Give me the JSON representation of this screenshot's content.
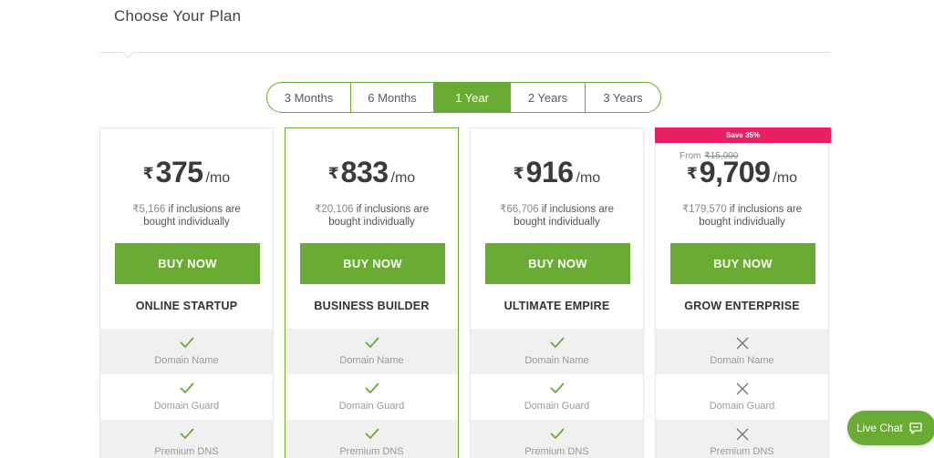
{
  "header": {
    "title": "Choose Your Plan"
  },
  "durations": [
    {
      "label": "3 Months",
      "active": false
    },
    {
      "label": "6 Months",
      "active": false
    },
    {
      "label": "1 Year",
      "active": true
    },
    {
      "label": "2 Years",
      "active": false
    },
    {
      "label": "3 Years",
      "active": false
    }
  ],
  "currency": "₹",
  "per": "/mo",
  "inclusion_suffix": " if inclusions are",
  "inclusion_suffix2": "bought individually",
  "buy_label": "BUY NOW",
  "plans": [
    {
      "name": "ONLINE STARTUP",
      "price": "375",
      "inclusion_value": "₹5,166",
      "featured": false,
      "features": [
        {
          "label": "Domain Name",
          "icon": "check-icon"
        },
        {
          "label": "Domain Guard",
          "icon": "check-icon"
        },
        {
          "label": "Premium DNS",
          "icon": "check-icon"
        }
      ]
    },
    {
      "name": "BUSINESS BUILDER",
      "price": "833",
      "inclusion_value": "₹20,106",
      "featured": true,
      "features": [
        {
          "label": "Domain Name",
          "icon": "check-icon"
        },
        {
          "label": "Domain Guard",
          "icon": "check-icon"
        },
        {
          "label": "Premium DNS",
          "icon": "check-icon"
        }
      ]
    },
    {
      "name": "ULTIMATE EMPIRE",
      "price": "916",
      "inclusion_value": "₹66,706",
      "featured": false,
      "features": [
        {
          "label": "Domain Name",
          "icon": "check-icon"
        },
        {
          "label": "Domain Guard",
          "icon": "check-icon"
        },
        {
          "label": "Premium DNS",
          "icon": "check-icon"
        }
      ]
    },
    {
      "name": "GROW ENTERPRISE",
      "price": "9,709",
      "inclusion_value": "₹179,570",
      "featured": false,
      "save_badge": "Save 35%",
      "from_label": "From",
      "original_price": "₹15,000",
      "features": [
        {
          "label": "Domain Name",
          "icon": "cross-icon"
        },
        {
          "label": "Domain Guard",
          "icon": "cross-icon"
        },
        {
          "label": "Premium DNS",
          "icon": "cross-icon"
        }
      ]
    }
  ],
  "live_chat": {
    "label": "Live Chat",
    "icon": "chat-icon"
  },
  "colors": {
    "accent": "#6aab33",
    "badge": "#e91e63",
    "shade": "#f0f0f0"
  }
}
